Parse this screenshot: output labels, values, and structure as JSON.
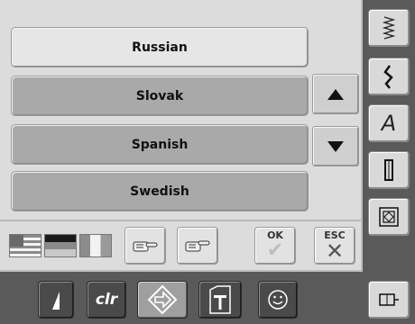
{
  "languages": {
    "items": [
      {
        "label": "Russian",
        "selected": true
      },
      {
        "label": "Slovak",
        "selected": false
      },
      {
        "label": "Spanish",
        "selected": false
      },
      {
        "label": "Swedish",
        "selected": false
      }
    ]
  },
  "scroll": {
    "up_icon": "up-triangle-icon",
    "down_icon": "down-triangle-icon"
  },
  "toolbar": {
    "flags": [
      "us-flag-icon",
      "german-flag-icon",
      "french-flag-icon"
    ],
    "ok_label": "OK",
    "esc_label": "ESC"
  },
  "right_bar": {
    "icons": [
      "zigzag-stitch-icon",
      "wavy-stitch-icon",
      "alphabet-icon",
      "buttonhole-icon",
      "quilt-icon",
      "setup-icon"
    ],
    "alphabet_letter": "A"
  },
  "bottom_bar": {
    "clr_label": "clr"
  },
  "colors": {
    "panel_bg": "#dcdcdc",
    "frame_bg": "#5a5a5a",
    "list_button": "#a9a9a9",
    "selected_button": "#e6e6e6"
  }
}
